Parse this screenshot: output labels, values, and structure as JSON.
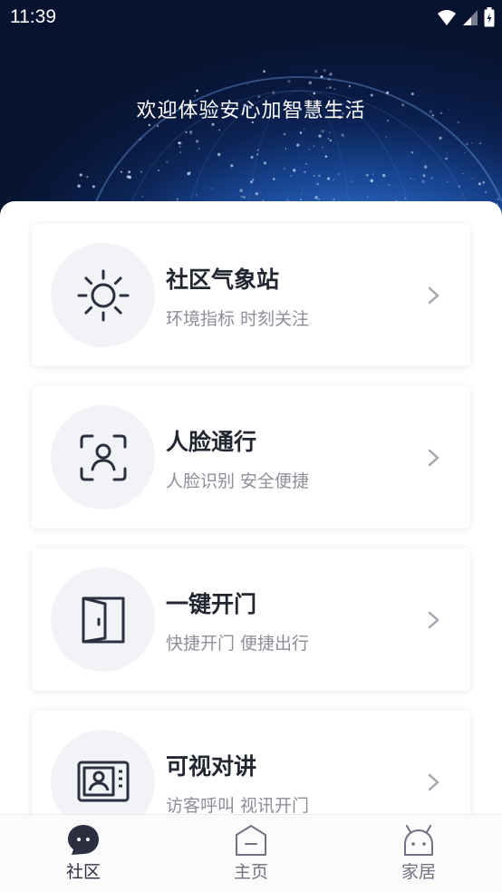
{
  "status_bar": {
    "time": "11:39"
  },
  "hero": {
    "welcome_text": "欢迎体验安心加智慧生活"
  },
  "cards": [
    {
      "title": "社区气象站",
      "subtitle": "环境指标 时刻关注",
      "icon": "sun-icon"
    },
    {
      "title": "人脸通行",
      "subtitle": "人脸识别 安全便捷",
      "icon": "face-scan-icon"
    },
    {
      "title": "一键开门",
      "subtitle": "快捷开门 便捷出行",
      "icon": "door-icon"
    },
    {
      "title": "可视对讲",
      "subtitle": "访客呼叫 视讯开门",
      "icon": "video-intercom-icon"
    }
  ],
  "tab_bar": {
    "active_color": "#2c2f3f",
    "inactive_color": "#6f7280",
    "items": [
      {
        "label": "社区",
        "icon": "chat-bubble-icon",
        "active": true
      },
      {
        "label": "主页",
        "icon": "home-icon",
        "active": false
      },
      {
        "label": "家居",
        "icon": "android-icon",
        "active": false
      }
    ]
  }
}
